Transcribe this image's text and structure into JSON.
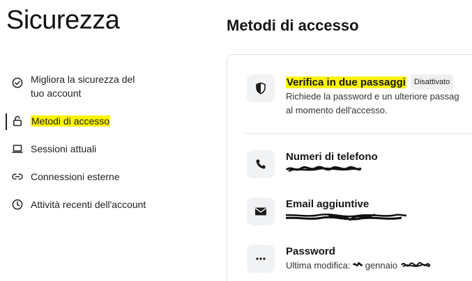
{
  "page": {
    "title": "Sicurezza"
  },
  "sidebar": {
    "items": [
      {
        "label": "Migliora la sicurezza del tuo account",
        "icon": "check-circle-icon"
      },
      {
        "label": "Metodi di accesso",
        "icon": "lock-icon",
        "active": true
      },
      {
        "label": "Sessioni attuali",
        "icon": "laptop-icon"
      },
      {
        "label": "Connessioni esterne",
        "icon": "link-icon"
      },
      {
        "label": "Attività recenti dell'account",
        "icon": "clock-icon"
      }
    ]
  },
  "main": {
    "section_title": "Metodi di accesso",
    "two_factor": {
      "title": "Verifica in due passaggi",
      "status": "Disattivato",
      "description_line1": "Richiede la password e un ulteriore passag",
      "description_line2": "al momento dell'accesso.",
      "icon": "shield-icon"
    },
    "phone": {
      "title": "Numeri di telefono",
      "icon": "phone-icon"
    },
    "email": {
      "title": "Email aggiuntive",
      "icon": "mail-icon"
    },
    "password": {
      "title": "Password",
      "last_modified_prefix": "Ultima modifica:",
      "last_modified_month": "gennaio",
      "icon": "dots-icon"
    }
  },
  "colors": {
    "highlight": "#fbf400",
    "tile_bg": "#f1f2f4",
    "text": "#151515"
  }
}
